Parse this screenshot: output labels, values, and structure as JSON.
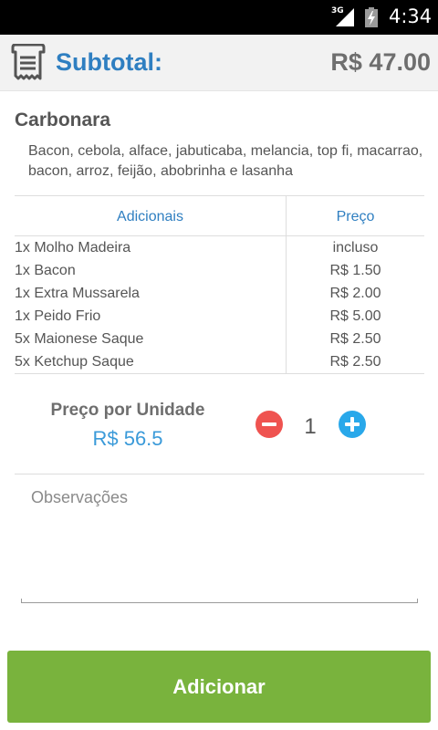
{
  "status_bar": {
    "network": "3G",
    "time": "4:34"
  },
  "header": {
    "icon": "receipt-icon",
    "subtotal_label": "Subtotal:",
    "subtotal_value": "R$ 47.00"
  },
  "item": {
    "name": "Carbonara",
    "description": "Bacon, cebola, alface, jabuticaba, melancia, top fi, macarrao, bacon, arroz, feijão, abobrinha e lasanha"
  },
  "extras": {
    "headers": {
      "name": "Adicionais",
      "price": "Preço"
    },
    "rows": [
      {
        "name": "1x Molho Madeira",
        "price": "incluso"
      },
      {
        "name": "1x Bacon",
        "price": "R$ 1.50"
      },
      {
        "name": "1x Extra Mussarela",
        "price": "R$ 2.00"
      },
      {
        "name": "1x Peido Frio",
        "price": "R$ 5.00"
      },
      {
        "name": "5x Maionese Saque",
        "price": "R$ 2.50"
      },
      {
        "name": "5x Ketchup Saque",
        "price": "R$ 2.50"
      }
    ]
  },
  "unit_price": {
    "label": "Preço por Unidade",
    "value": "R$ 56.5"
  },
  "quantity": {
    "value": "1",
    "minus_icon": "minus-circle-icon",
    "plus_icon": "plus-circle-icon"
  },
  "observations": {
    "placeholder": "Observações",
    "value": ""
  },
  "add_button": {
    "label": "Adicionar"
  },
  "colors": {
    "accent_blue": "#2f7fc1",
    "price_blue": "#3a9ad9",
    "minus_red": "#ef5350",
    "plus_blue": "#29a8ea",
    "button_green": "#79b33d"
  }
}
